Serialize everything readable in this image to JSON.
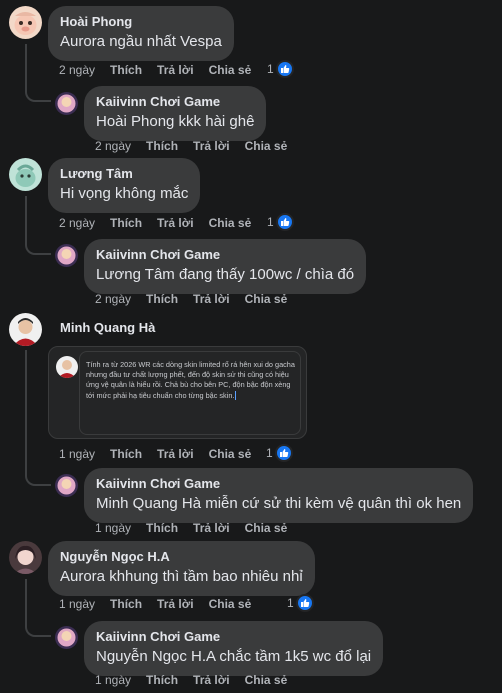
{
  "actions": {
    "like": "Thích",
    "reply": "Trả lời",
    "share": "Chia sẻ"
  },
  "colors": {
    "background": "#18191a",
    "bubble": "#3a3b3c",
    "like_blue": "#1877f2",
    "meta_text": "#b0b3b8"
  },
  "comments": [
    {
      "author": "Hoài Phong",
      "text": "Aurora ngầu nhất Vespa",
      "time": "2 ngày",
      "reactions": "1",
      "reply": {
        "author": "Kaiivinn Chơi Game",
        "text": "Hoài Phong kkk hài ghê",
        "time": "2 ngày"
      }
    },
    {
      "author": "Lương Tâm",
      "text": "Hi vọng không mắc",
      "time": "2 ngày",
      "reactions": "1",
      "reply": {
        "author": "Kaiivinn Chơi Game",
        "text": "Lương Tâm đang thấy 100wc / chìa đó",
        "time": "2 ngày"
      }
    },
    {
      "author": "Minh Quang Hà",
      "text": "",
      "attachment_text": "Tính ra từ 2026 WR các dòng skin limited rổ rá hên xui do gacha nhưng đầu tư chất lượng phết, đến độ skin sử thi cũng có hiệu ứng vệ quân là hiểu rồi. Chả bù cho bên PC, độn bậc độn xèng tới mức phải hạ tiêu chuẩn cho từng bậc skin.",
      "time": "1 ngày",
      "reactions": "1",
      "reply": {
        "author": "Kaiivinn Chơi Game",
        "text": "Minh Quang Hà miễn cứ sử thi kèm vệ quân thì ok hen",
        "time": "1 ngày"
      }
    },
    {
      "author": "Nguyễn Ngọc H.A",
      "text": "Aurora khhung thì tầm bao nhiêu nhỉ",
      "time": "1 ngày",
      "reactions": "1",
      "reply": {
        "author": "Kaiivinn Chơi Game",
        "text": "Nguyễn Ngọc H.A chắc tầm 1k5 wc đổ lại",
        "time": "1 ngày"
      }
    }
  ]
}
